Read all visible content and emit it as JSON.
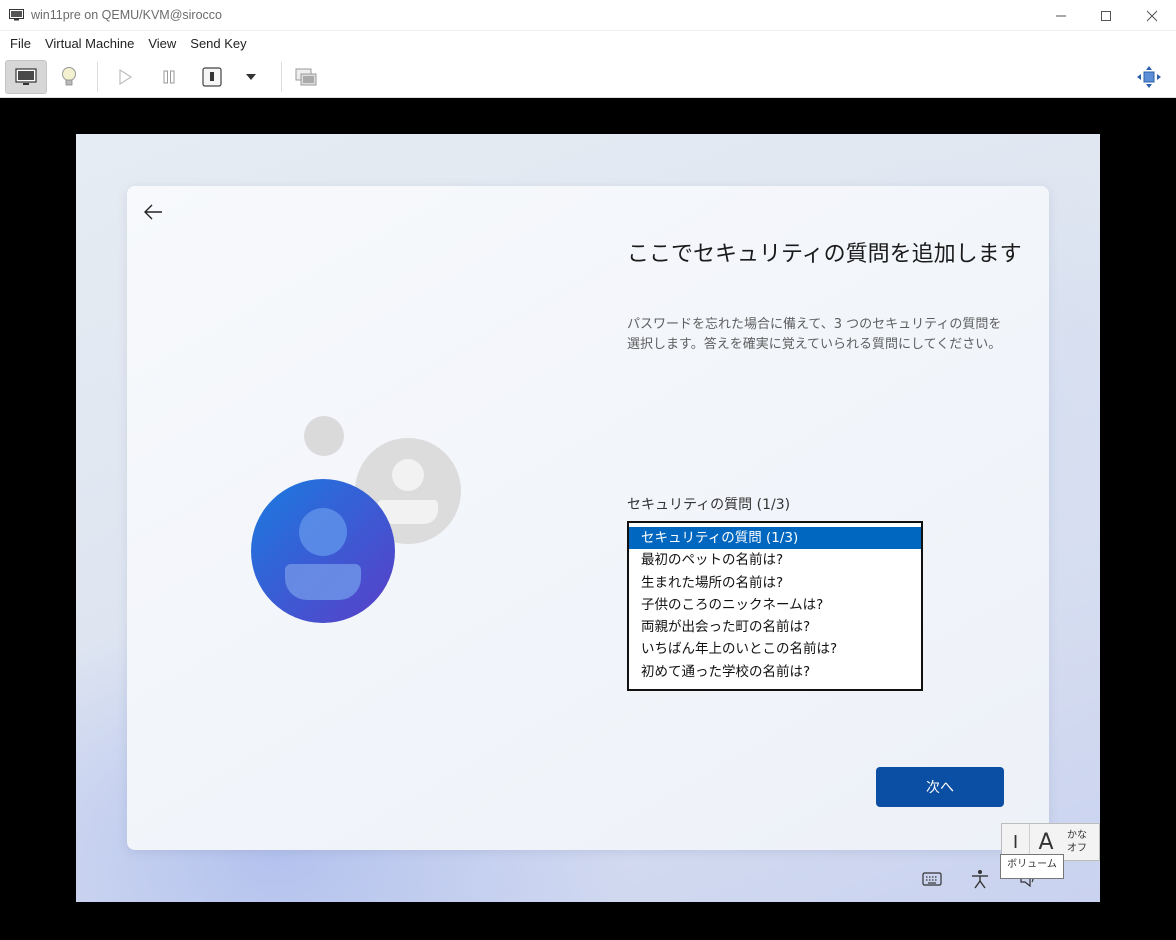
{
  "window": {
    "title": "win11pre on QEMU/KVM@sirocco"
  },
  "menu": {
    "items": [
      "File",
      "Virtual Machine",
      "View",
      "Send Key"
    ]
  },
  "toolbar": {
    "icons": [
      "console-icon",
      "details-lightbulb-icon",
      "run-icon",
      "pause-icon",
      "power-icon",
      "power-menu-chevron-icon",
      "snapshots-icon",
      "fullscreen-icon"
    ]
  },
  "oobe": {
    "heading": "ここでセキュリティの質問を追加します",
    "description": "パスワードを忘れた場合に備えて、3 つのセキュリティの質問を選択します。答えを確実に覚えていられる質問にしてください。",
    "field_label": "セキュリティの質問 (1/3)",
    "options": [
      "セキュリティの質問 (1/3)",
      "最初のペットの名前は?",
      "生まれた場所の名前は?",
      "子供のころのニックネームは?",
      "両親が出会った町の名前は?",
      "いちばん年上のいとこの名前は?",
      "初めて通った学校の名前は?"
    ],
    "selected_index": 0,
    "next_label": "次へ"
  },
  "ime": {
    "mode": "I",
    "input_char": "A",
    "kana_label": "かな オフ",
    "tooltip": "ボリューム"
  },
  "colors": {
    "accent": "#0067c0",
    "next_button": "#0a4fa3",
    "avatar_blue": "#2a6fdc"
  }
}
